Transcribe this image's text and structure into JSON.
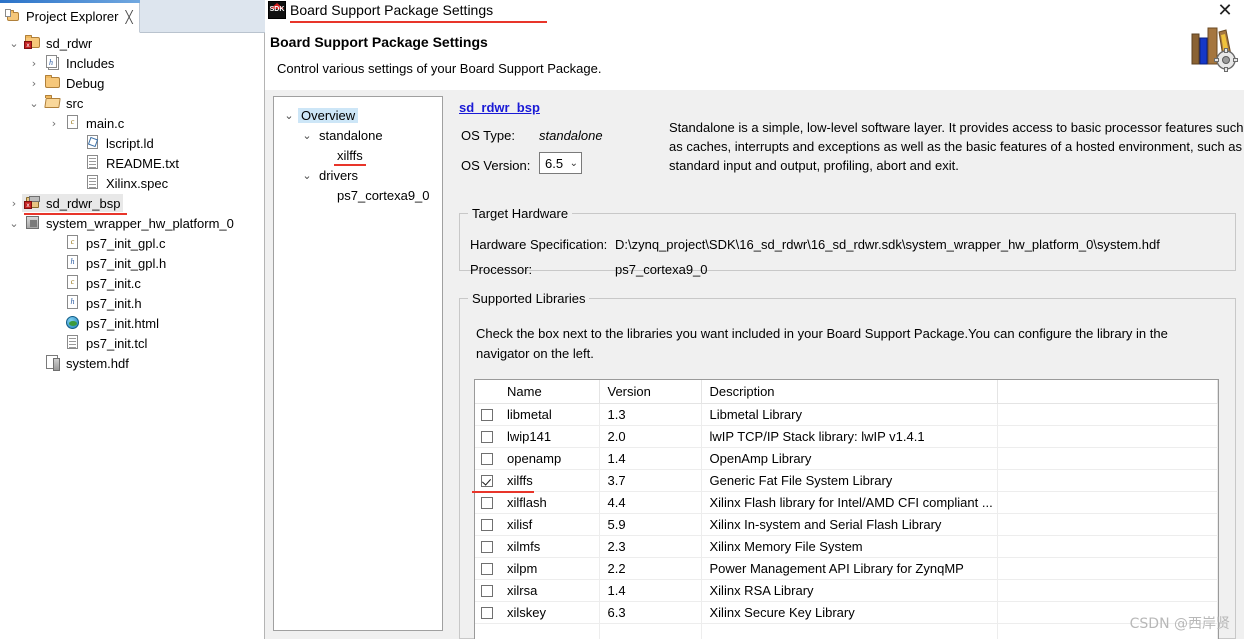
{
  "explorer": {
    "tab": {
      "label": "Project Explorer",
      "icon": "project-explorer-icon",
      "close_glyph": "╳"
    },
    "tree": [
      {
        "label": "sd_rdwr",
        "arrow": "⌄",
        "icon": "project-icon",
        "indent": 0,
        "selected": false,
        "underline": false
      },
      {
        "label": "Includes",
        "arrow": "›",
        "icon": "includes-icon",
        "indent": 1,
        "selected": false,
        "underline": false
      },
      {
        "label": "Debug",
        "arrow": "›",
        "icon": "folder-icon",
        "indent": 1,
        "selected": false,
        "underline": false
      },
      {
        "label": "src",
        "arrow": "⌄",
        "icon": "folder-open-icon",
        "indent": 1,
        "selected": false,
        "underline": false
      },
      {
        "label": "main.c",
        "arrow": "›",
        "icon": "c-file-icon",
        "indent": 2,
        "selected": false,
        "underline": false
      },
      {
        "label": "lscript.ld",
        "arrow": "",
        "icon": "linker-script-icon",
        "indent": 3,
        "selected": false,
        "underline": false
      },
      {
        "label": "README.txt",
        "arrow": "",
        "icon": "text-file-icon",
        "indent": 3,
        "selected": false,
        "underline": false
      },
      {
        "label": "Xilinx.spec",
        "arrow": "",
        "icon": "text-file-icon",
        "indent": 3,
        "selected": false,
        "underline": false
      },
      {
        "label": "sd_rdwr_bsp",
        "arrow": "›",
        "icon": "bsp-project-icon",
        "indent": 0,
        "selected": true,
        "underline": true
      },
      {
        "label": "system_wrapper_hw_platform_0",
        "arrow": "⌄",
        "icon": "hw-platform-icon",
        "indent": 0,
        "selected": false,
        "underline": false
      },
      {
        "label": "ps7_init_gpl.c",
        "arrow": "",
        "icon": "c-file-icon",
        "indent": 2,
        "selected": false,
        "underline": false
      },
      {
        "label": "ps7_init_gpl.h",
        "arrow": "",
        "icon": "h-file-icon",
        "indent": 2,
        "selected": false,
        "underline": false
      },
      {
        "label": "ps7_init.c",
        "arrow": "",
        "icon": "c-file-icon",
        "indent": 2,
        "selected": false,
        "underline": false
      },
      {
        "label": "ps7_init.h",
        "arrow": "",
        "icon": "h-file-icon",
        "indent": 2,
        "selected": false,
        "underline": false
      },
      {
        "label": "ps7_init.html",
        "arrow": "",
        "icon": "html-file-icon",
        "indent": 2,
        "selected": false,
        "underline": false
      },
      {
        "label": "ps7_init.tcl",
        "arrow": "",
        "icon": "text-file-icon",
        "indent": 2,
        "selected": false,
        "underline": false
      },
      {
        "label": "system.hdf",
        "arrow": "",
        "icon": "hdf-file-icon",
        "indent": 1,
        "selected": false,
        "underline": false
      }
    ]
  },
  "dialog": {
    "window_title": "Board Support Package Settings",
    "window_icon": "sdk-icon",
    "close_glyph": "✕",
    "header_title": "Board Support Package Settings",
    "header_subtitle": "Control various settings of your Board Support Package.",
    "banner_icon": "books-and-gear-icon",
    "navigator": [
      {
        "label": "Overview",
        "arrow": "⌄",
        "indent": 0,
        "selected": true,
        "underline": false
      },
      {
        "label": "standalone",
        "arrow": "⌄",
        "indent": 1,
        "selected": false,
        "underline": false
      },
      {
        "label": "xilffs",
        "arrow": "",
        "indent": 2,
        "selected": false,
        "underline": true
      },
      {
        "label": "drivers",
        "arrow": "⌄",
        "indent": 1,
        "selected": false,
        "underline": false
      },
      {
        "label": "ps7_cortexa9_0",
        "arrow": "",
        "indent": 2,
        "selected": false,
        "underline": false
      }
    ],
    "overview": {
      "bsp_name": "sd_rdwr_bsp",
      "os_type_label": "OS Type:",
      "os_type_value": "standalone",
      "os_version_label": "OS Version:",
      "os_version_value": "6.5",
      "os_version_chevron": "⌄",
      "os_description": "Standalone is a simple, low-level software layer. It provides access to basic processor features such as caches, interrupts and exceptions as well as the basic features of a hosted environment, such as standard input and output, profiling, abort and exit."
    },
    "target_hardware": {
      "legend": "Target Hardware",
      "hw_spec_label": "Hardware Specification:",
      "hw_spec_value": "D:\\zynq_project\\SDK\\16_sd_rdwr\\16_sd_rdwr.sdk\\system_wrapper_hw_platform_0\\system.hdf",
      "processor_label": "Processor:",
      "processor_value": "ps7_cortexa9_0"
    },
    "supported_libraries": {
      "legend": "Supported Libraries",
      "instructions": "Check the box next to the libraries you want included in your Board Support Package.You can configure the library in the navigator on the left.",
      "columns": [
        "",
        "Name",
        "Version",
        "Description",
        ""
      ],
      "rows": [
        {
          "checked": false,
          "name": "libmetal",
          "version": "1.3",
          "description": "Libmetal Library"
        },
        {
          "checked": false,
          "name": "lwip141",
          "version": "2.0",
          "description": "lwIP TCP/IP Stack library: lwIP v1.4.1"
        },
        {
          "checked": false,
          "name": "openamp",
          "version": "1.4",
          "description": "OpenAmp Library"
        },
        {
          "checked": true,
          "name": "xilffs",
          "version": "3.7",
          "description": "Generic Fat File System Library"
        },
        {
          "checked": false,
          "name": "xilflash",
          "version": "4.4",
          "description": "Xilinx Flash library for Intel/AMD CFI compliant ..."
        },
        {
          "checked": false,
          "name": "xilisf",
          "version": "5.9",
          "description": "Xilinx In-system and Serial Flash Library"
        },
        {
          "checked": false,
          "name": "xilmfs",
          "version": "2.3",
          "description": "Xilinx Memory File System"
        },
        {
          "checked": false,
          "name": "xilpm",
          "version": "2.2",
          "description": "Power Management API Library for ZynqMP"
        },
        {
          "checked": false,
          "name": "xilrsa",
          "version": "1.4",
          "description": "Xilinx RSA Library"
        },
        {
          "checked": false,
          "name": "xilskey",
          "version": "6.3",
          "description": "Xilinx Secure Key Library"
        },
        {
          "checked": false,
          "name": "",
          "version": "",
          "description": ""
        }
      ]
    }
  },
  "watermark": "CSDN @西岸贤",
  "colors": {
    "annotation_red": "#e8352a",
    "link_blue": "#1a1ad6",
    "selection_blue": "#cde6f7",
    "panel_gray": "#f0f0f0"
  }
}
